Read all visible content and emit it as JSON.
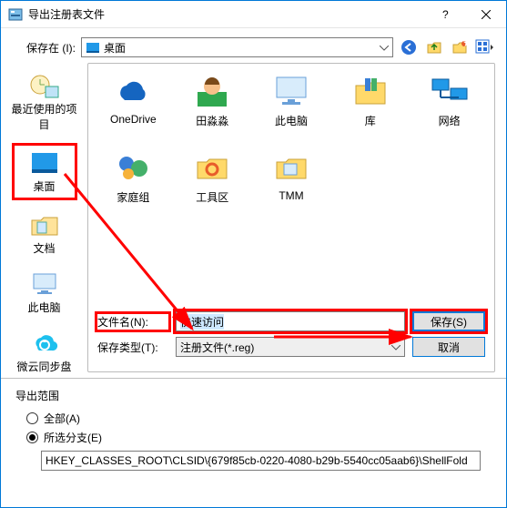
{
  "window": {
    "title": "导出注册表文件"
  },
  "savein": {
    "label": "保存在 (I):",
    "value": "桌面"
  },
  "places": [
    {
      "id": "recent",
      "label": "最近使用的项目"
    },
    {
      "id": "desktop",
      "label": "桌面"
    },
    {
      "id": "documents",
      "label": "文档"
    },
    {
      "id": "thispc",
      "label": "此电脑"
    },
    {
      "id": "weiyun",
      "label": "微云同步盘"
    }
  ],
  "files": [
    {
      "id": "onedrive",
      "label": "OneDrive"
    },
    {
      "id": "user",
      "label": "田淼淼"
    },
    {
      "id": "thispc2",
      "label": "此电脑"
    },
    {
      "id": "library",
      "label": "库"
    },
    {
      "id": "network",
      "label": "网络"
    },
    {
      "id": "homegroup",
      "label": "家庭组"
    },
    {
      "id": "toolbox",
      "label": "工具区"
    },
    {
      "id": "tmm",
      "label": "TMM"
    }
  ],
  "filename": {
    "label": "文件名(N):",
    "value": "快速访问"
  },
  "filetype": {
    "label": "保存类型(T):",
    "value": "注册文件(*.reg)"
  },
  "buttons": {
    "save": "保存(S)",
    "cancel": "取消"
  },
  "export": {
    "legend": "导出范围",
    "opt_all": "全部(A)",
    "opt_branch": "所选分支(E)",
    "branch_path": "HKEY_CLASSES_ROOT\\CLSID\\{679f85cb-0220-4080-b29b-5540cc05aab6}\\ShellFold"
  }
}
